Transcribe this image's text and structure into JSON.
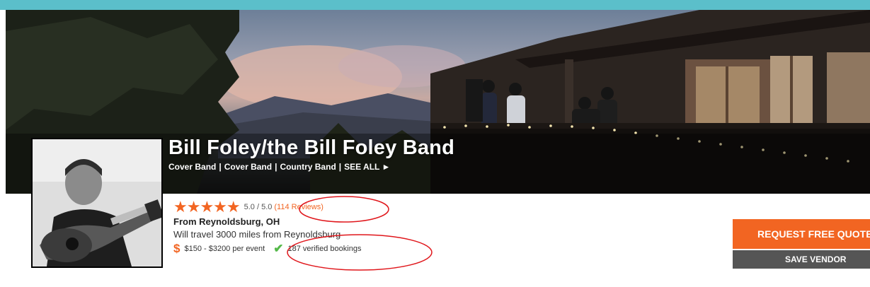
{
  "header": {
    "title": "Bill Foley/the Bill Foley Band",
    "categories": [
      "Cover Band",
      "Cover Band",
      "Country Band"
    ],
    "see_all": "SEE ALL ►"
  },
  "rating": {
    "stars": "★★★★★",
    "value": "5.0 / 5.0",
    "reviews": "(114 Reviews)"
  },
  "location": "From Reynoldsburg, OH",
  "travel": "Will travel 3000 miles from Reynoldsburg",
  "price": {
    "symbol": "$",
    "range": "$150 - $3200 per event"
  },
  "bookings": {
    "check": "✔",
    "label": "187 verified bookings"
  },
  "actions": {
    "request_quote": "REQUEST FREE QUOTE",
    "save_vendor": "SAVE VENDOR"
  },
  "colors": {
    "accent": "#f26522",
    "top_strip": "#5bbfca",
    "verified": "#55b94a",
    "annotation": "#e0161b",
    "save_button": "#555555"
  }
}
